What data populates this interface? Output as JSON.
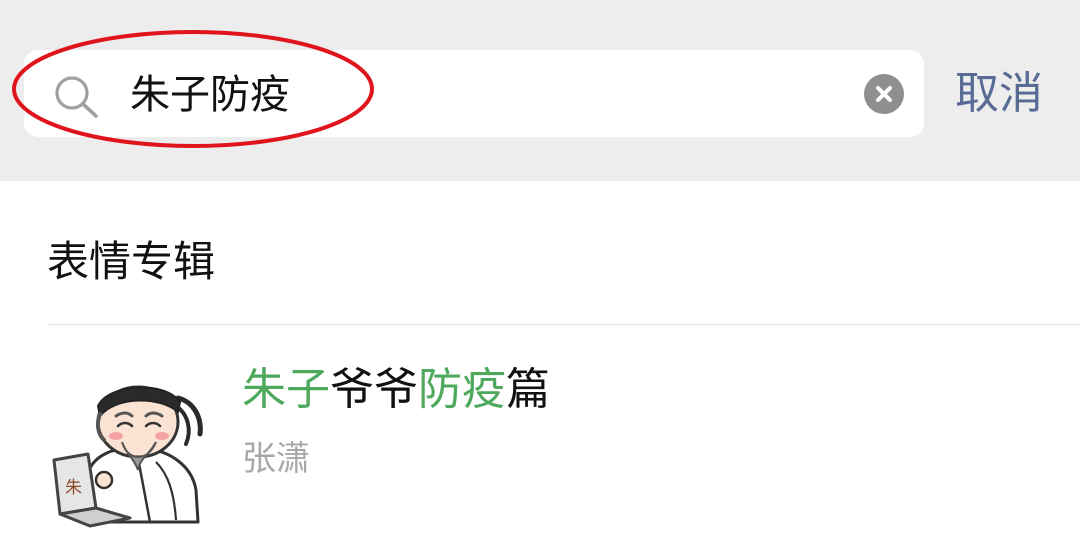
{
  "search": {
    "query": "朱子防疫",
    "cancel_label": "取消"
  },
  "section": {
    "title": "表情专辑"
  },
  "results": [
    {
      "title_parts": [
        {
          "text": "朱子",
          "highlight": true
        },
        {
          "text": "爷爷",
          "highlight": false
        },
        {
          "text": "防疫",
          "highlight": true
        },
        {
          "text": "篇",
          "highlight": false
        }
      ],
      "author": "张潇",
      "thumbnail_icon": "scholar-sticker-icon",
      "laptop_label": "朱"
    }
  ],
  "colors": {
    "header_bg": "#ededed",
    "highlight": "#4ea95d",
    "link": "#576b95",
    "annotation": "#e0141d"
  }
}
